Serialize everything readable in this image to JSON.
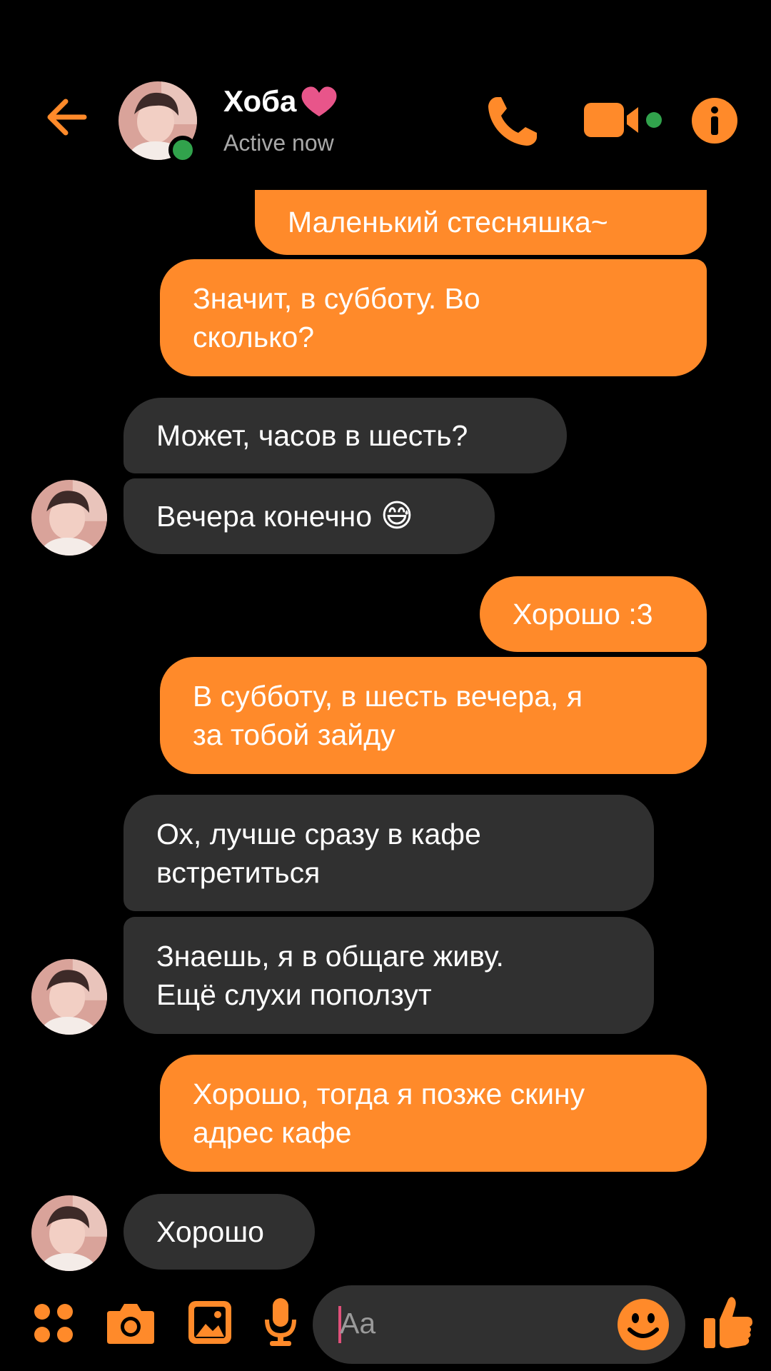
{
  "header": {
    "contact_name": "Хоба",
    "status": "Active now"
  },
  "messages": [
    {
      "from": "me",
      "lines": [
        "Маленький стесняшка~"
      ]
    },
    {
      "from": "me",
      "lines": [
        "Значит, в субботу. Во",
        "сколько?"
      ]
    },
    {
      "from": "them",
      "lines": [
        "Может, часов в шесть?"
      ]
    },
    {
      "from": "them",
      "lines": [
        "Вечера конечно"
      ],
      "emoji": "😅"
    },
    {
      "from": "me",
      "lines": [
        "Хорошо :3"
      ]
    },
    {
      "from": "me",
      "lines": [
        "В субботу, в шесть вечера, я",
        "за тобой зайду"
      ]
    },
    {
      "from": "them",
      "lines": [
        "Ох, лучше сразу в кафе",
        "встретиться"
      ]
    },
    {
      "from": "them",
      "lines": [
        "Знаешь, я в общаге живу.",
        "Ещё слухи поползут"
      ]
    },
    {
      "from": "me",
      "lines": [
        "Хорошо, тогда я позже скину",
        "адрес кафе"
      ]
    },
    {
      "from": "them",
      "lines": [
        "Хорошо"
      ]
    }
  ],
  "composer": {
    "placeholder": "Aa",
    "icons": [
      "apps-icon",
      "camera-icon",
      "gallery-icon",
      "microphone-icon",
      "emoji-icon",
      "thumbs-up-icon"
    ]
  },
  "colors": {
    "accent": "#ff8a2a",
    "incoming_bubble": "#303030",
    "online": "#31a24c",
    "heart": "#e8558a",
    "background": "#000000"
  }
}
